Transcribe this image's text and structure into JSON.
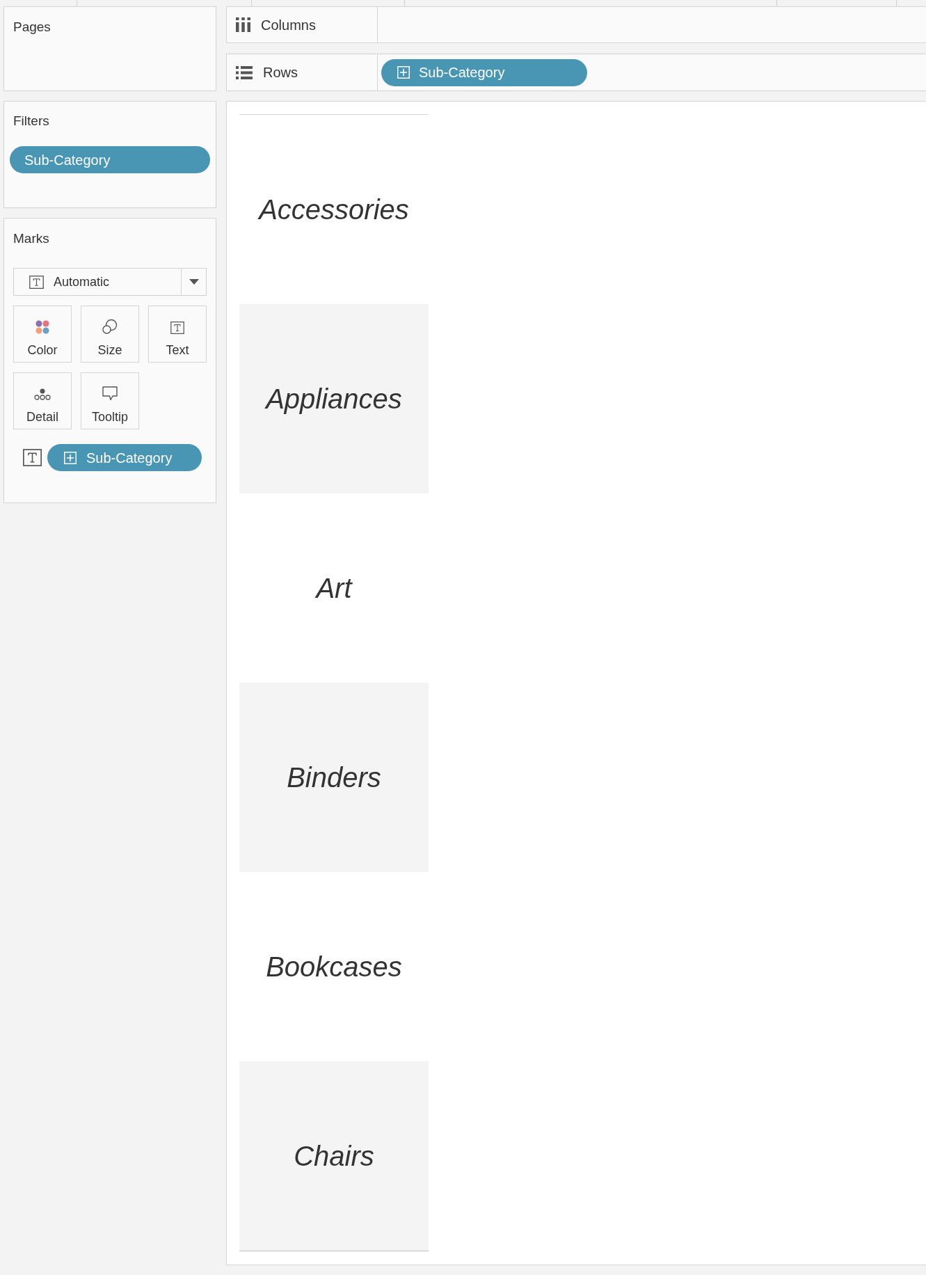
{
  "pages": {
    "title": "Pages"
  },
  "filters": {
    "title": "Filters",
    "pills": [
      {
        "label": "Sub-Category",
        "expandable": false
      }
    ]
  },
  "marks": {
    "title": "Marks",
    "mark_type": {
      "kind": "text",
      "label": "Automatic"
    },
    "buttons": [
      {
        "kind": "color",
        "label": "Color"
      },
      {
        "kind": "size",
        "label": "Size"
      },
      {
        "kind": "text",
        "label": "Text"
      },
      {
        "kind": "detail",
        "label": "Detail"
      },
      {
        "kind": "tooltip",
        "label": "Tooltip"
      }
    ],
    "fields": [
      {
        "kind": "text",
        "label": "Sub-Category",
        "expandable": true
      }
    ]
  },
  "shelves": [
    {
      "kind": "columns",
      "label": "Columns"
    },
    {
      "kind": "rows",
      "label": "Rows",
      "pills": [
        {
          "label": "Sub-Category",
          "expandable": true
        }
      ]
    }
  ],
  "view": {
    "rows": [
      {
        "label": "Accessories"
      },
      {
        "label": "Appliances"
      },
      {
        "label": "Art"
      },
      {
        "label": "Binders"
      },
      {
        "label": "Bookcases"
      },
      {
        "label": "Chairs"
      }
    ]
  }
}
